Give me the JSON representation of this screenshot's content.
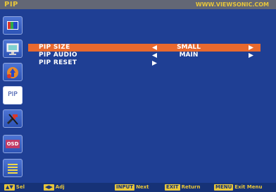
{
  "header": {
    "title": "PIP",
    "brand": "WWW.VIEWSONIC.COM"
  },
  "tabs": [
    {
      "id": "color",
      "icon": "color-bars-icon"
    },
    {
      "id": "monitor",
      "icon": "monitor-icon"
    },
    {
      "id": "source",
      "icon": "input-source-icon"
    },
    {
      "id": "pip",
      "icon": "pip-icon",
      "label": "PIP",
      "selected": true
    },
    {
      "id": "setup",
      "icon": "setup-tools-icon"
    },
    {
      "id": "osd",
      "icon": "osd-icon",
      "label": "OSD"
    },
    {
      "id": "menu",
      "icon": "menu-lines-icon"
    }
  ],
  "menu": {
    "rows": [
      {
        "label": "PIP SIZE",
        "value": "SMALL",
        "selected": true
      },
      {
        "label": "PIP AUDIO",
        "value": "MAIN",
        "selected": false
      },
      {
        "label": "PIP RESET",
        "value": "",
        "selected": false
      }
    ]
  },
  "footer": {
    "sel_key": "▲▼",
    "sel": "Sel",
    "adj_key": "◀▶",
    "adj": "Adj",
    "next_key": "INPUT",
    "next": "Next",
    "return_key": "EXIT",
    "return_label": "Return",
    "exit_key": "MENU",
    "exit_menu": "Exit Menu"
  },
  "colors": {
    "background": "#1f3f94",
    "highlight": "#e8692e",
    "accent": "#e8c63a",
    "titlebar": "#636775"
  }
}
